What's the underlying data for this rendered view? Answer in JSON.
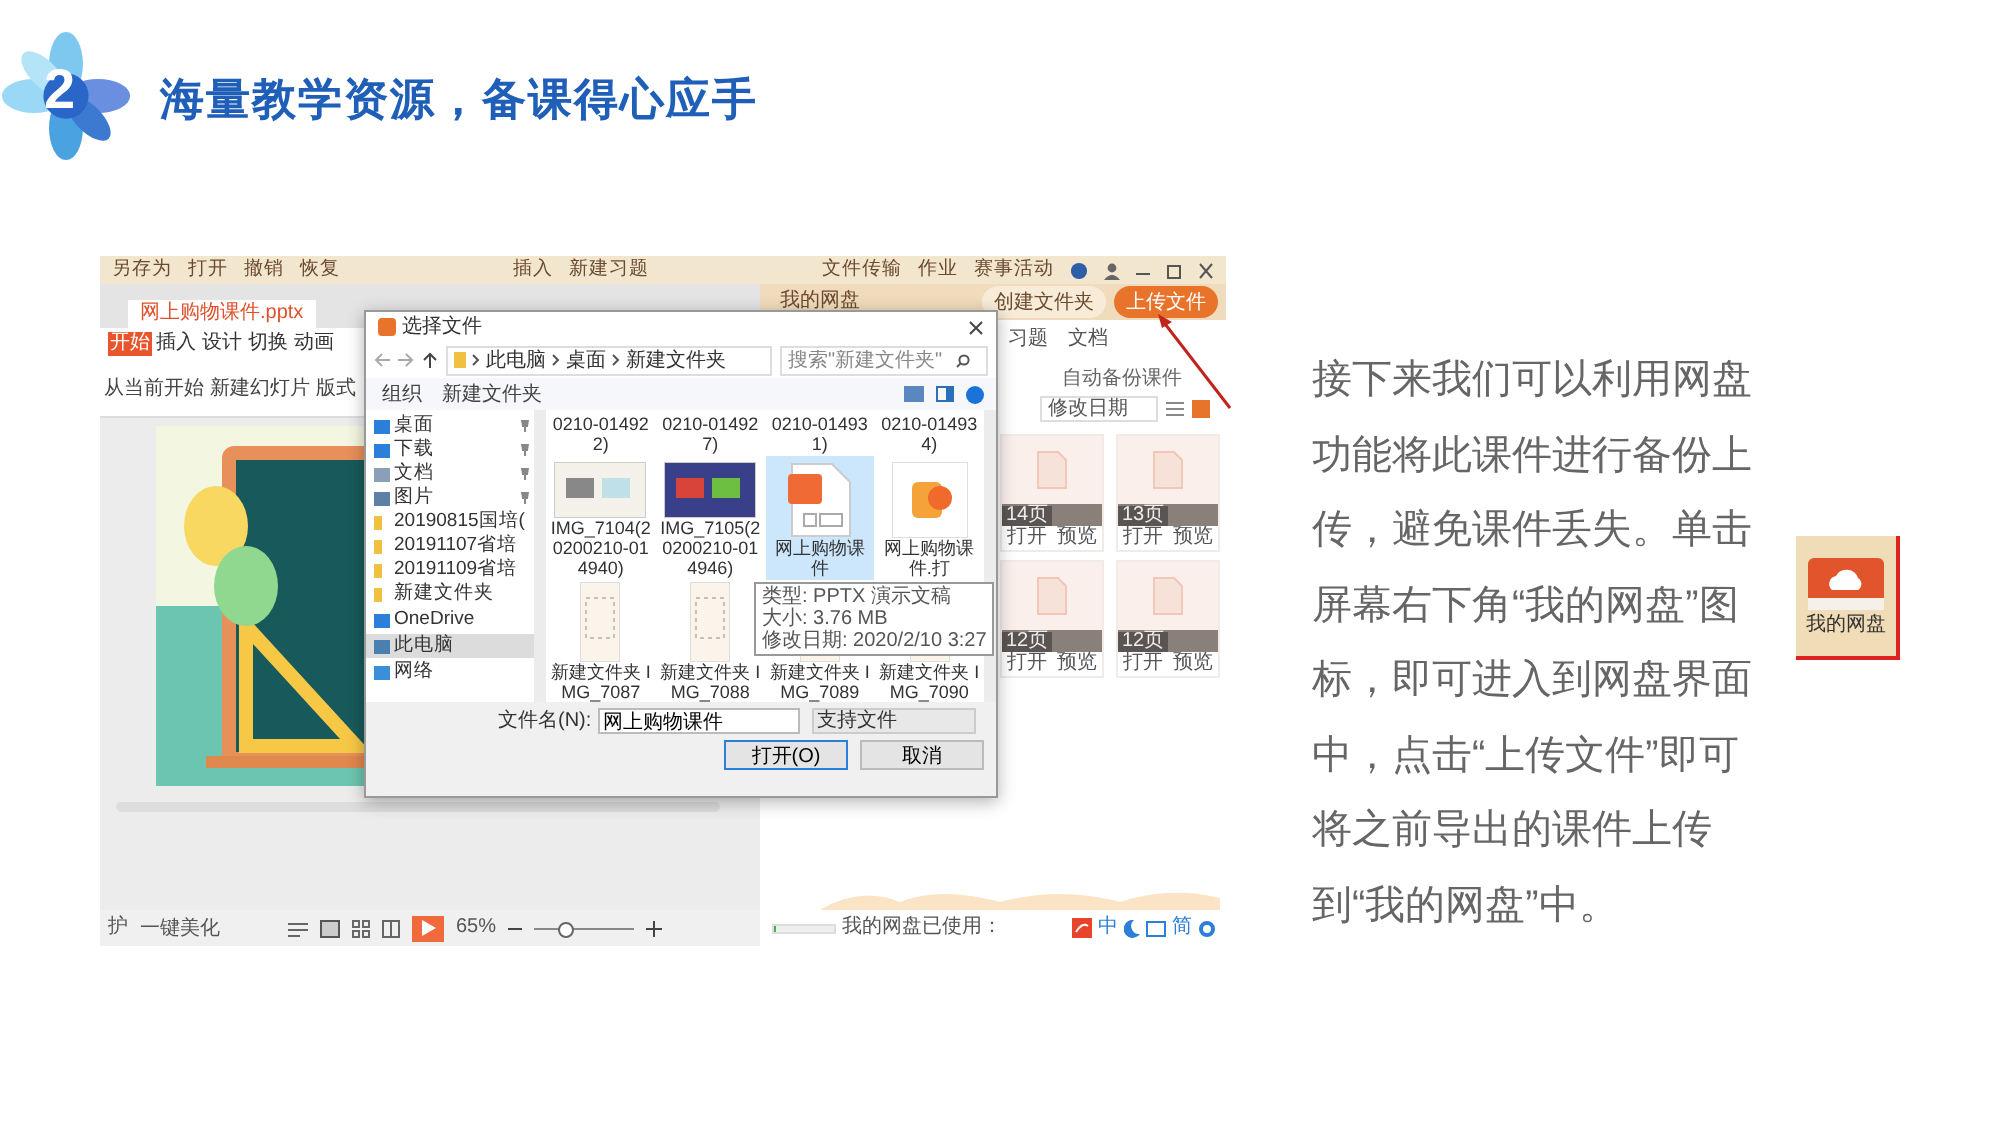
{
  "slide": {
    "number": "2",
    "title": "海量教学资源，备课得心应手"
  },
  "screenshot": {
    "top_toolbar": {
      "left_items": [
        "另存为",
        "打开",
        "撤销",
        "恢复"
      ],
      "center_items": [
        "插入",
        "新建习题"
      ],
      "right_items": [
        "文件传输",
        "作业",
        "赛事活动"
      ]
    },
    "wps": {
      "doc_tab": "网上购物课件.pptx",
      "ribbon_tabs": [
        {
          "label": "开始",
          "selected": true
        },
        {
          "label": "插入",
          "selected": false
        },
        {
          "label": "设计",
          "selected": false
        },
        {
          "label": "切换",
          "selected": false
        },
        {
          "label": "动画",
          "selected": false
        }
      ],
      "ribbon_buttons": [
        "从当前开始",
        "新建幻灯片",
        "版式"
      ],
      "status": {
        "left_text": "护",
        "beautify": "一键美化",
        "zoom": "65%",
        "zoom_slider": {
          "level": 0.3
        }
      }
    },
    "netdisk": {
      "title": "我的网盘",
      "new_folder": "创建文件夹",
      "upload": "上传文件",
      "tabs": [
        {
          "label": "习题",
          "selected": false
        },
        {
          "label": "文档",
          "selected": false
        }
      ],
      "auto_backup": "自动备份课件",
      "sort": "修改日期",
      "cards": [
        {
          "pages": "14页",
          "actions": [
            "打开",
            "预览"
          ]
        },
        {
          "pages": "13页",
          "actions": [
            "打开",
            "预览"
          ]
        },
        {
          "pages": "12页",
          "actions": [
            "打开",
            "预览"
          ]
        },
        {
          "pages": "12页",
          "actions": [
            "打开",
            "预览"
          ]
        }
      ],
      "usage": {
        "label": "我的网盘已使用：",
        "level": 0.03
      },
      "ime": [
        "中",
        "简"
      ]
    },
    "dialog": {
      "title": "选择文件",
      "path": [
        "此电脑",
        "桌面",
        "新建文件夹"
      ],
      "search_placeholder": "搜索\"新建文件夹\"",
      "organize": "组织",
      "new_folder": "新建文件夹",
      "sidebar": [
        {
          "label": "桌面",
          "kind": "desktop",
          "pinned": true,
          "selected": false
        },
        {
          "label": "下载",
          "kind": "download",
          "pinned": true,
          "selected": false
        },
        {
          "label": "文档",
          "kind": "document",
          "pinned": true,
          "selected": false
        },
        {
          "label": "图片",
          "kind": "picture",
          "pinned": true,
          "selected": false
        },
        {
          "label": "20190815国培(",
          "kind": "folder",
          "pinned": false,
          "selected": false
        },
        {
          "label": "20191107省培",
          "kind": "folder",
          "pinned": false,
          "selected": false
        },
        {
          "label": "20191109省培",
          "kind": "folder",
          "pinned": false,
          "selected": false
        },
        {
          "label": "新建文件夹",
          "kind": "folder",
          "pinned": false,
          "selected": false
        },
        {
          "label": "OneDrive",
          "kind": "cloud",
          "pinned": false,
          "selected": false
        },
        {
          "label": "此电脑",
          "kind": "computer",
          "pinned": false,
          "selected": true
        },
        {
          "label": "网络",
          "kind": "network",
          "pinned": false,
          "selected": false
        }
      ],
      "files": [
        {
          "name": "0210-014922)",
          "kind": "cut",
          "selected": false
        },
        {
          "name": "0210-014927)",
          "kind": "cut",
          "selected": false
        },
        {
          "name": "0210-014931)",
          "kind": "cut",
          "selected": false
        },
        {
          "name": "0210-014934)",
          "kind": "cut",
          "selected": false
        },
        {
          "name": "IMG_7104(20200210-014940)",
          "kind": "image",
          "selected": false
        },
        {
          "name": "IMG_7105(20200210-014946)",
          "kind": "image",
          "selected": false
        },
        {
          "name": "网上购物课件",
          "kind": "pptx",
          "selected": true
        },
        {
          "name": "网上购物课件.打",
          "kind": "app",
          "selected": false
        },
        {
          "name": "新建文件夹 IMG_7087",
          "kind": "phone",
          "selected": false
        },
        {
          "name": "新建文件夹 IMG_7088",
          "kind": "phone",
          "selected": false
        },
        {
          "name": "新建文件夹 IMG_7089",
          "kind": "phone",
          "selected": false
        },
        {
          "name": "新建文件夹 IMG_7090",
          "kind": "phone",
          "selected": false
        }
      ],
      "tooltip": [
        "类型: PPTX 演示文稿",
        "大小: 3.76 MB",
        "修改日期: 2020/2/10 3:27"
      ],
      "filename_label": "文件名(N):",
      "filename": "网上购物课件",
      "filter": "支持文件",
      "open": "打开(O)",
      "cancel": "取消"
    }
  },
  "description": "接下来我们可以利用网盘功能将此课件进行备份上传，避免课件丢失。单击屏幕右下角“我的网盘”图标，即可进入到网盘界面中，点击“上传文件”即可将之前导出的课件上传到“我的网盘”中。",
  "netdisk_icon": {
    "label": "我的网盘"
  }
}
